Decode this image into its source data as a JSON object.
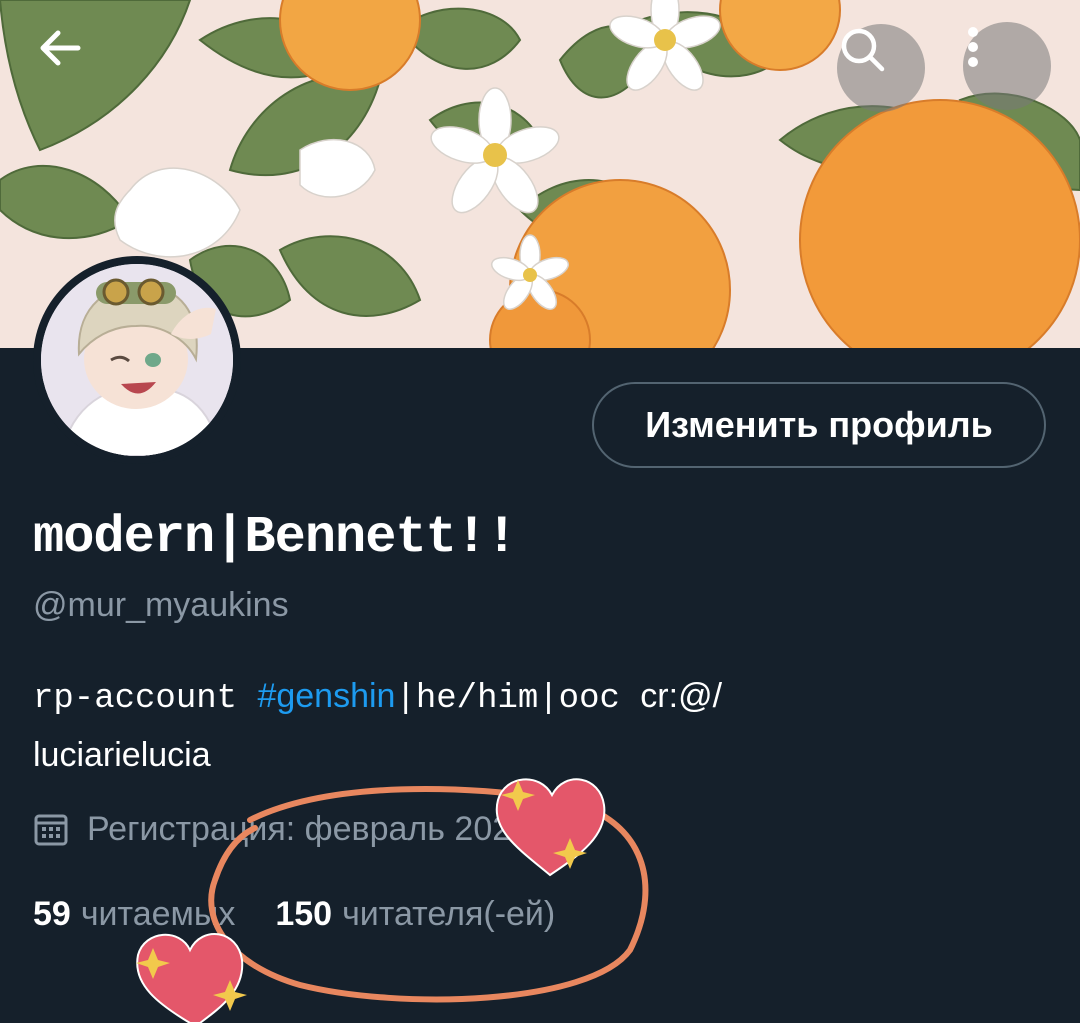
{
  "header": {
    "back_icon": "arrow-left-icon",
    "search_icon": "search-icon",
    "more_icon": "more-vertical-icon"
  },
  "profile": {
    "edit_button_label": "Изменить профиль",
    "display_name": "modern|Bennett!!",
    "handle": "@mur_myaukins",
    "bio": {
      "part1": "rp-account ",
      "hashtag": "#genshin",
      "part2": "|he/him|ooc ",
      "part3": "cr:@/",
      "part4": "luciarielucia"
    },
    "joined": "Регистрация: февраль 2021 г.",
    "following_count": "59",
    "following_label": "читаемых",
    "followers_count": "150",
    "followers_label": "читателя(-ей)"
  },
  "colors": {
    "background": "#15202b",
    "accent": "#1d9bf0",
    "secondary_text": "#8b98a5",
    "annotation_circle": "#e8875f",
    "heart": "#e4576a"
  }
}
